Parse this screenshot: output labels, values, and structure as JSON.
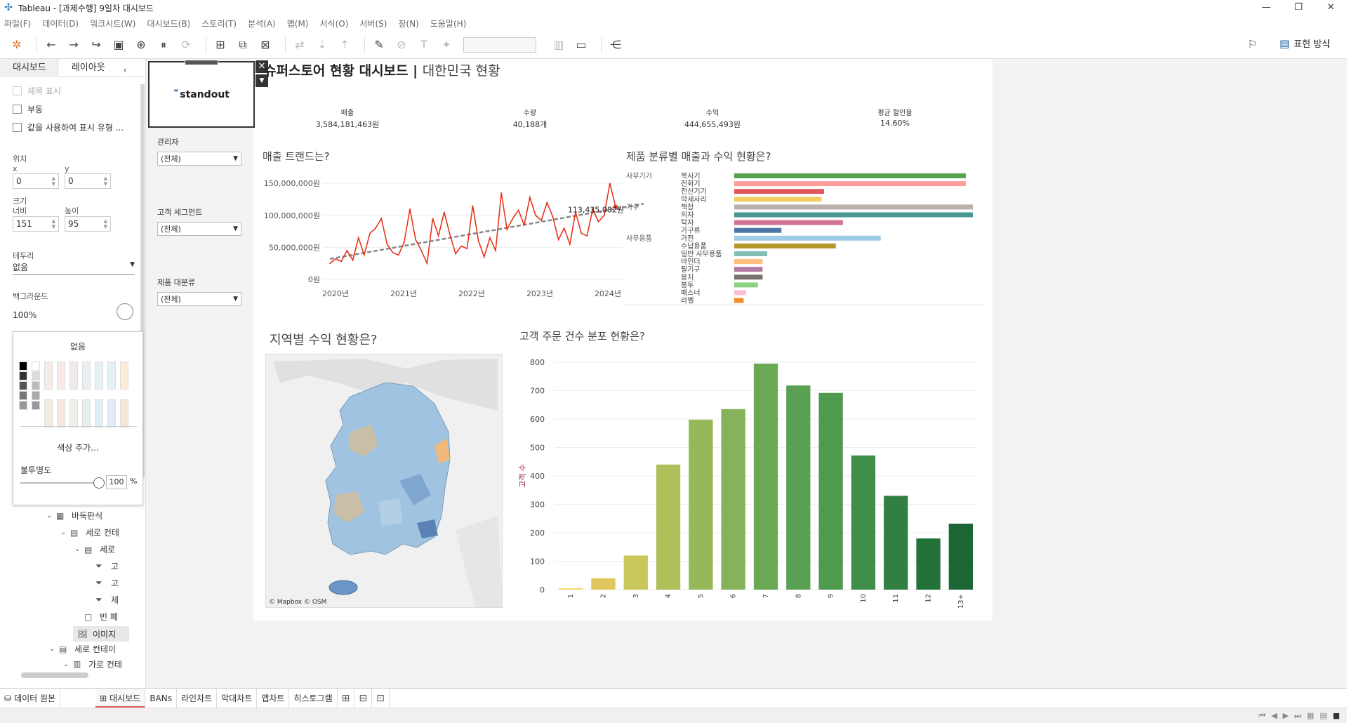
{
  "window": {
    "title": "Tableau - [과제수행] 9일차 대시보드",
    "controls": [
      "—",
      "❐",
      "✕"
    ]
  },
  "menu": [
    "파일(F)",
    "데이터(D)",
    "워크시트(W)",
    "대시보드(B)",
    "스토리(T)",
    "분석(A)",
    "맵(M)",
    "서식(O)",
    "서버(S)",
    "창(N)",
    "도움말(H)"
  ],
  "toolbar": {
    "presentation_label": "표현 방식"
  },
  "left_panel": {
    "tabs": [
      "대시보드",
      "레이아웃"
    ],
    "checkbox_title": "제목 표시",
    "checkbox_floating": "부동",
    "checkbox_show_values": "값을 사용하여 표시 유형 ...",
    "position_label": "위치",
    "x_label": "x",
    "y_label": "y",
    "x_value": "0",
    "y_value": "0",
    "size_label": "크기",
    "width_label": "너비",
    "height_label": "높이",
    "width_value": "151",
    "height_value": "95",
    "border_label": "테두리",
    "border_value": "없음",
    "background_label": "백그라운드",
    "background_value": "100%",
    "color_popover": {
      "none_label": "없음",
      "add_color": "색상 추가...",
      "opacity_label": "불투명도",
      "opacity_value": "100",
      "opacity_unit": "%"
    },
    "tree": [
      {
        "label": "바둑판식",
        "icon": "tiled-icon"
      },
      {
        "label": "세로 컨테",
        "icon": "vertical-container-icon"
      },
      {
        "label": "세로",
        "icon": "vertical-container-icon"
      },
      {
        "label": "고",
        "icon": "filter-icon"
      },
      {
        "label": "고",
        "icon": "filter-icon"
      },
      {
        "label": "제",
        "icon": "filter-icon"
      },
      {
        "label": "빈 페",
        "icon": "blank-icon"
      },
      {
        "label": "이미지",
        "icon": "image-icon"
      },
      {
        "label": "세로 컨테이",
        "icon": "vertical-container-icon"
      },
      {
        "label": "가로 컨테",
        "icon": "horizontal-container-icon"
      }
    ]
  },
  "dashboard": {
    "logo_text": "standout",
    "title_main": "슈퍼스토어 현황 대시보드 | ",
    "title_sub": "대한민국 현황",
    "filters": [
      {
        "label": "관리자",
        "value": "(전체)"
      },
      {
        "label": "고객 세그먼트",
        "value": "(전체)"
      },
      {
        "label": "제품 대분류",
        "value": "(전체)"
      }
    ],
    "kpis": [
      {
        "label": "매출",
        "value": "3,584,181,463원"
      },
      {
        "label": "수량",
        "value": "40,188개"
      },
      {
        "label": "수익",
        "value": "444,655,493원"
      },
      {
        "label": "평균 할인율",
        "value": "14.60%"
      }
    ],
    "q_trend": "매출 트랜드는?",
    "q_category": "제품 분류별 매출과 수익 현황은?",
    "q_region": "지역별 수익 현황은?",
    "q_customers": "고객 주문 건수 분포 현황은?",
    "map_credit": "© Mapbox © OSM"
  },
  "chart_data": [
    {
      "type": "line",
      "title": "매출 트랜드는?",
      "y_ticks": [
        "0원",
        "50,000,000원",
        "100,000,000원",
        "150,000,000원"
      ],
      "x_ticks": [
        "2020년",
        "2021년",
        "2022년",
        "2023년",
        "2024년"
      ],
      "ylim": [
        0,
        160000000
      ],
      "annotation": "113,435,082원",
      "trend_line": {
        "start": 32000000,
        "end": 118000000,
        "color": "#888888"
      },
      "series": [
        {
          "color": "#e8341c",
          "values": [
            25000000,
            32000000,
            28000000,
            45000000,
            30000000,
            65000000,
            38000000,
            72000000,
            80000000,
            95000000,
            55000000,
            42000000,
            38000000,
            58000000,
            110000000,
            62000000,
            45000000,
            25000000,
            95000000,
            68000000,
            105000000,
            70000000,
            40000000,
            52000000,
            48000000,
            115000000,
            60000000,
            35000000,
            65000000,
            45000000,
            135000000,
            78000000,
            95000000,
            108000000,
            85000000,
            128000000,
            100000000,
            92000000,
            120000000,
            98000000,
            62000000,
            80000000,
            55000000,
            105000000,
            72000000,
            68000000,
            110000000,
            90000000,
            100000000,
            150000000,
            113435082
          ]
        }
      ]
    },
    {
      "type": "bar",
      "title": "제품 분류별 매출과 수익 현황은?",
      "groups": [
        {
          "name": "사무기기",
          "categories": [
            "복사기",
            "전화기",
            "전산기기",
            "악세사리"
          ]
        },
        {
          "name": "가구",
          "categories": [
            "책장",
            "의자",
            "탁자",
            "가구류"
          ]
        },
        {
          "name": "사무용품",
          "categories": [
            "가전",
            "수납용품",
            "일반 사무용품",
            "바인더",
            "필기구",
            "용지",
            "봉투",
            "패스너",
            "라벨"
          ]
        }
      ],
      "categories": [
        "복사기",
        "전화기",
        "전산기기",
        "악세사리",
        "책장",
        "의자",
        "탁자",
        "가구류",
        "가전",
        "수납용품",
        "일반 사무용품",
        "바인더",
        "필기구",
        "용지",
        "봉투",
        "패스너",
        "라벨"
      ],
      "values": [
        98,
        98,
        38,
        37,
        101,
        101,
        46,
        20,
        62,
        43,
        14,
        12,
        12,
        12,
        10,
        5,
        4
      ],
      "colors": [
        "#59a14f",
        "#ff9d9a",
        "#e15759",
        "#f1ce63",
        "#bab0ac",
        "#499894",
        "#d37295",
        "#4e79a7",
        "#a0cbe8",
        "#b6992d",
        "#86bcb6",
        "#ffbe7d",
        "#b07aa1",
        "#79706e",
        "#8cd17d",
        "#fabfd2",
        "#f28e2b"
      ]
    },
    {
      "type": "bar",
      "title": "고객 주문 건수 분포 현황은?",
      "ylabel": "고객 수",
      "ylim": [
        0,
        800
      ],
      "y_ticks": [
        0,
        100,
        200,
        300,
        400,
        500,
        600,
        700,
        800
      ],
      "categories": [
        "1",
        "2",
        "3",
        "4",
        "5",
        "6",
        "7",
        "8",
        "9",
        "10",
        "11",
        "12",
        "13+"
      ],
      "values": [
        5,
        40,
        120,
        440,
        598,
        635,
        795,
        718,
        692,
        472,
        330,
        180,
        232
      ],
      "colors": [
        "#f5d96b",
        "#dfc65e",
        "#c9c75a",
        "#aec05a",
        "#96b85a",
        "#85b25a",
        "#6aa854",
        "#5aa052",
        "#4e9a4e",
        "#3f8f48",
        "#327f42",
        "#24713a",
        "#1b6634"
      ]
    }
  ],
  "sheet_tabs": [
    {
      "label": "데이터 원본",
      "active": false
    },
    {
      "label": "대시보드",
      "active": true
    },
    {
      "label": "BANs",
      "active": false
    },
    {
      "label": "라인차트",
      "active": false
    },
    {
      "label": "막대차트",
      "active": false
    },
    {
      "label": "맵차트",
      "active": false
    },
    {
      "label": "히스토그램",
      "active": false
    }
  ]
}
